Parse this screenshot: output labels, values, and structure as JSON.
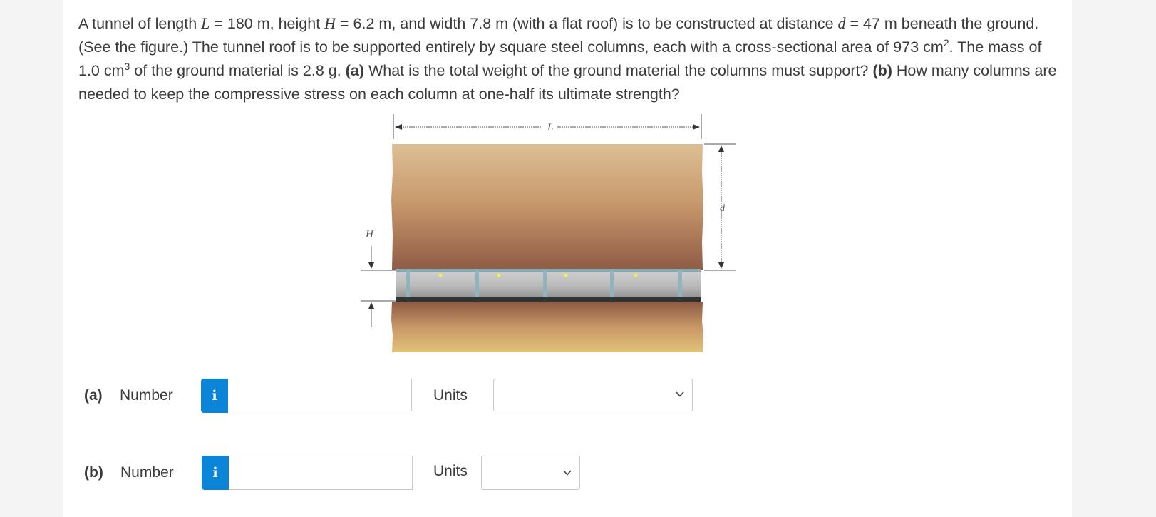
{
  "question": {
    "t1": "A tunnel of length ",
    "L": "L",
    "t2": " = 180 m, height ",
    "H": "H",
    "t3": " = 6.2 m, and width 7.8 m (with a flat roof) is to be constructed at distance ",
    "d": "d",
    "t4": " = 47 m beneath the ground. (See the figure.) The tunnel roof is to be supported entirely by square steel columns, each with a cross-sectional area of 973 cm",
    "sup2": "2",
    "t5": ". The mass of 1.0 cm",
    "sup3": "3",
    "t6": " of the ground material is 2.8 g. ",
    "a_tag": "(a)",
    "t7": " What is the total weight of the ground material the columns must support? ",
    "b_tag": "(b)",
    "t8": " How many columns are needed to keep the compressive stress on each column at one-half its ultimate strength?"
  },
  "figure": {
    "label_L": "L",
    "label_H": "H",
    "label_d": "d",
    "colors": {
      "ground_top": "#d9b98a",
      "ground_mid": "#c4956a",
      "ground_dark": "#8c5a44",
      "tunnel": "#b9b9b9",
      "column": "#7aa7b4"
    }
  },
  "parts": [
    {
      "tag": "(a)",
      "label": "Number",
      "info_icon": "i",
      "value": "",
      "units_label": "Units",
      "units_value": ""
    },
    {
      "tag": "(b)",
      "label": "Number",
      "info_icon": "i",
      "value": "",
      "units_label": "Units",
      "units_value": ""
    }
  ]
}
